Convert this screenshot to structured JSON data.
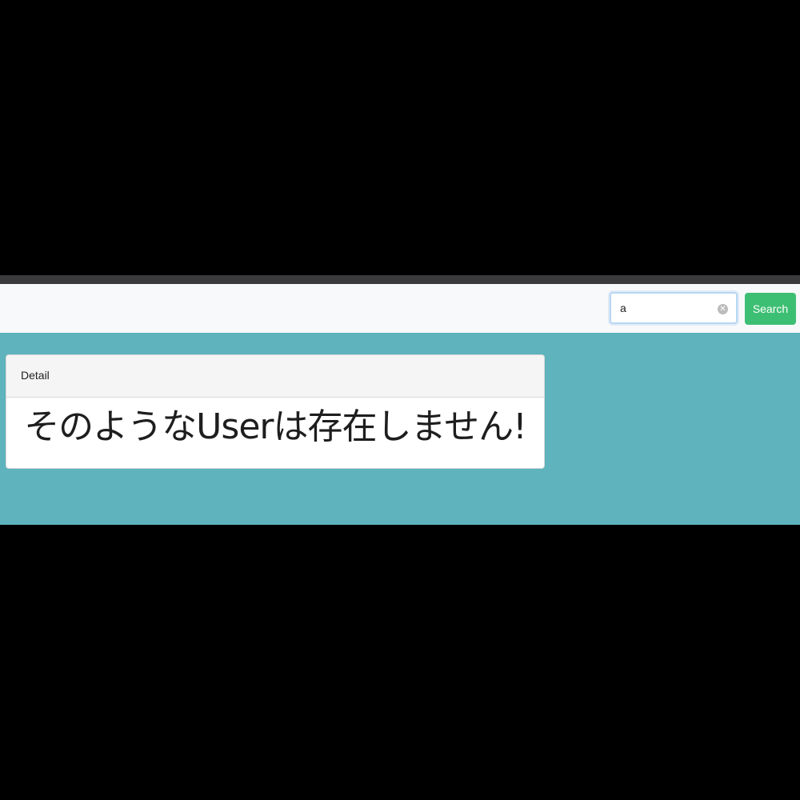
{
  "navbar": {
    "search": {
      "value": "a",
      "clear_icon": "clear-circle-icon"
    },
    "search_button_label": "Search"
  },
  "card": {
    "header": "Detail",
    "message": "そのようなUserは存在しません!"
  },
  "colors": {
    "main_background": "#5eb3bd",
    "search_button": "#3dbf73",
    "navbar_background": "#f8f9fa"
  }
}
